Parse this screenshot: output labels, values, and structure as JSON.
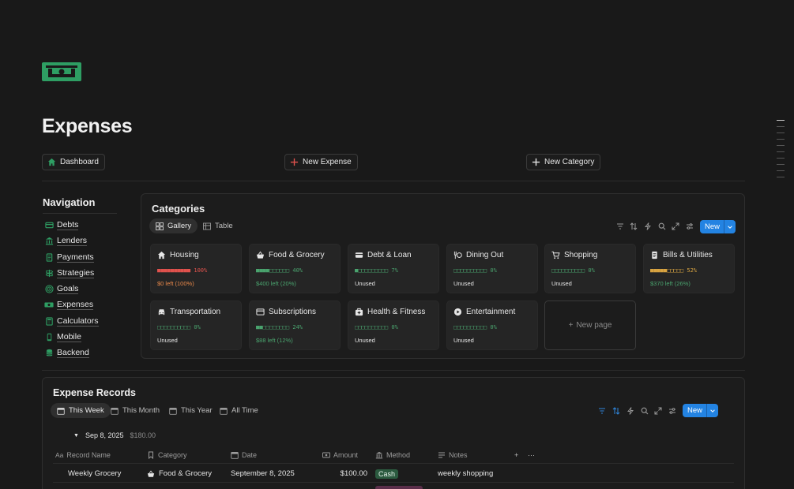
{
  "page": {
    "title": "Expenses"
  },
  "top_buttons": {
    "dashboard": "Dashboard",
    "new_expense": "New Expense",
    "new_category": "New Category"
  },
  "navigation": {
    "title": "Navigation",
    "items": [
      {
        "label": "Debts",
        "icon": "card-icon"
      },
      {
        "label": "Lenders",
        "icon": "bank-icon"
      },
      {
        "label": "Payments",
        "icon": "receipt-icon"
      },
      {
        "label": "Strategies",
        "icon": "signpost-icon"
      },
      {
        "label": "Goals",
        "icon": "target-icon"
      },
      {
        "label": "Expenses",
        "icon": "cash-icon"
      },
      {
        "label": "Calculators",
        "icon": "calculator-icon"
      },
      {
        "label": "Mobile",
        "icon": "phone-icon"
      },
      {
        "label": "Backend",
        "icon": "database-icon"
      }
    ]
  },
  "categories": {
    "title": "Categories",
    "views": [
      "Gallery",
      "Table"
    ],
    "new_label": "New",
    "new_page_label": "New page",
    "cards": [
      {
        "name": "Housing",
        "icon": "house-icon",
        "bar": "■■■■■■■■■■",
        "percent": "100%",
        "bar_color": "#e0524d",
        "bar_filled": 10,
        "remaining": "$0 left (100%)",
        "remaining_color": "#e8884a"
      },
      {
        "name": "Food & Grocery",
        "icon": "basket-icon",
        "bar": "■■■■□□□□□□",
        "percent": "40%",
        "bar_color": "#4aa36e",
        "bar_filled": 4,
        "remaining": "$400 left (20%)",
        "remaining_color": "#4aa36e"
      },
      {
        "name": "Debt & Loan",
        "icon": "card-icon",
        "bar": "■□□□□□□□□□",
        "percent": "7%",
        "bar_color": "#4aa36e",
        "bar_filled": 1,
        "remaining": "Unused",
        "remaining_color": "#e6e6e6"
      },
      {
        "name": "Dining Out",
        "icon": "dining-icon",
        "bar": "□□□□□□□□□□",
        "percent": "0%",
        "bar_color": "#4aa36e",
        "bar_filled": 0,
        "remaining": "Unused",
        "remaining_color": "#e6e6e6"
      },
      {
        "name": "Shopping",
        "icon": "cart-icon",
        "bar": "□□□□□□□□□□",
        "percent": "0%",
        "bar_color": "#4aa36e",
        "bar_filled": 0,
        "remaining": "Unused",
        "remaining_color": "#e6e6e6"
      },
      {
        "name": "Bills & Utilities",
        "icon": "bill-icon",
        "bar": "■■■■■□□□□□",
        "percent": "52%",
        "bar_color": "#d9a441",
        "bar_filled": 5,
        "remaining": "$370 left (26%)",
        "remaining_color": "#4aa36e"
      },
      {
        "name": "Transportation",
        "icon": "car-icon",
        "bar": "□□□□□□□□□□",
        "percent": "0%",
        "bar_color": "#4aa36e",
        "bar_filled": 0,
        "remaining": "Unused",
        "remaining_color": "#e6e6e6"
      },
      {
        "name": "Subscriptions",
        "icon": "subscription-icon",
        "bar": "■■□□□□□□□□",
        "percent": "24%",
        "bar_color": "#4aa36e",
        "bar_filled": 2,
        "remaining": "$88 left (12%)",
        "remaining_color": "#4aa36e"
      },
      {
        "name": "Health & Fitness",
        "icon": "health-icon",
        "bar": "□□□□□□□□□□",
        "percent": "0%",
        "bar_color": "#4aa36e",
        "bar_filled": 0,
        "remaining": "Unused",
        "remaining_color": "#e6e6e6"
      },
      {
        "name": "Entertainment",
        "icon": "play-icon",
        "bar": "□□□□□□□□□□",
        "percent": "0%",
        "bar_color": "#4aa36e",
        "bar_filled": 0,
        "remaining": "Unused",
        "remaining_color": "#e6e6e6"
      }
    ]
  },
  "records": {
    "title": "Expense Records",
    "views": [
      "This Week",
      "This Month",
      "This Year",
      "All Time"
    ],
    "new_label": "New",
    "group": {
      "label": "Sep 8, 2025",
      "total": "$180.00"
    },
    "columns": [
      "Record Name",
      "Category",
      "Date",
      "Amount",
      "Method",
      "Notes"
    ],
    "rows": [
      {
        "name": "Weekly Grocery",
        "category": "Food & Grocery",
        "date": "September 8, 2025",
        "amount": "$100.00",
        "method": "Cash",
        "notes": "weekly shopping"
      }
    ]
  },
  "colors": {
    "accent": "#2383e2",
    "brand_green": "#2e9e63",
    "danger": "#e0524d"
  }
}
